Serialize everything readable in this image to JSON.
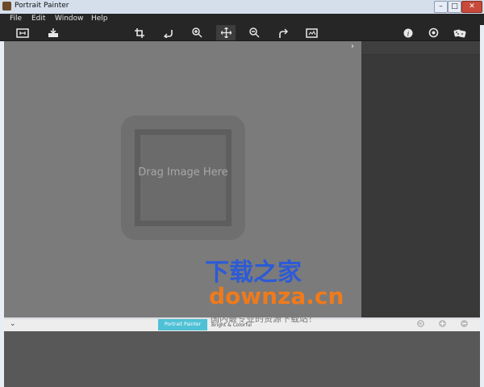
{
  "window": {
    "title": "Portrait Painter",
    "buttons": {
      "minimize": "–",
      "maximize": "□",
      "close": "✕"
    }
  },
  "menubar": {
    "items": [
      "File",
      "Edit",
      "Window",
      "Help"
    ]
  },
  "toolbar": {
    "left_icons": [
      "fit-screen-icon",
      "save-icon"
    ],
    "center_icons": [
      "crop-icon",
      "rotate-left-icon",
      "zoom-in-icon",
      "move-icon",
      "zoom-out-icon",
      "rotate-right-icon",
      "compare-icon"
    ],
    "right_icons": [
      "info-icon",
      "settings-icon",
      "random-dice-icon"
    ],
    "active_tool": "move-icon"
  },
  "canvas": {
    "drop_prompt": "Drag Image Here",
    "collapse_glyph": "›"
  },
  "bottom_bar": {
    "expand_glyph": "⌄",
    "preset_label": "Portrait Painter",
    "preset_sub": "Bright & Colorful",
    "controls": [
      "undo-icon",
      "add-icon",
      "remove-icon"
    ]
  },
  "watermark": {
    "line1": "下载之家",
    "line2": "downza.cn",
    "line3": "国内最专业的资源下载站！"
  },
  "colors": {
    "accent": "#4fc1d6",
    "canvas_bg": "#7b7b7b",
    "toolbar_bg": "#262626",
    "sidebar_bg": "#393939",
    "panel_bg": "#585858"
  }
}
